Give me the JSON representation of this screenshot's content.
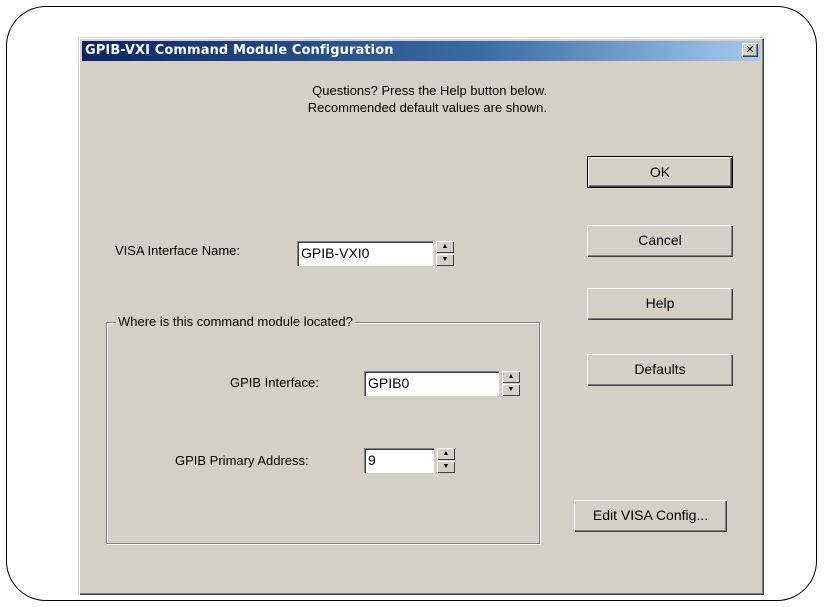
{
  "dialog": {
    "title": "GPIB-VXI Command Module Configuration",
    "close_symbol": "✕",
    "message_line1": "Questions?  Press the Help button below.",
    "message_line2": "Recommended default values are shown."
  },
  "fields": {
    "visa_interface_label": "VISA Interface Name:",
    "visa_interface_value": "GPIB-VXI0",
    "group_label": "Where is this command module located?",
    "gpib_interface_label": "GPIB Interface:",
    "gpib_interface_value": "GPIB0",
    "gpib_address_label": "GPIB Primary Address:",
    "gpib_address_value": "9"
  },
  "buttons": {
    "ok": "OK",
    "cancel": "Cancel",
    "help": "Help",
    "defaults": "Defaults",
    "edit_visa_config": "Edit VISA Config..."
  },
  "icons": {
    "spin_up": "▲",
    "spin_down": "▼"
  }
}
